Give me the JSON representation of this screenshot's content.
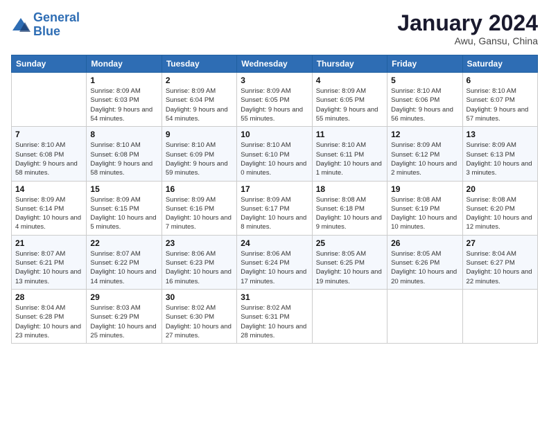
{
  "logo": {
    "line1": "General",
    "line2": "Blue"
  },
  "title": "January 2024",
  "subtitle": "Awu, Gansu, China",
  "weekdays": [
    "Sunday",
    "Monday",
    "Tuesday",
    "Wednesday",
    "Thursday",
    "Friday",
    "Saturday"
  ],
  "weeks": [
    [
      {
        "day": "",
        "sunrise": "",
        "sunset": "",
        "daylight": ""
      },
      {
        "day": "1",
        "sunrise": "Sunrise: 8:09 AM",
        "sunset": "Sunset: 6:03 PM",
        "daylight": "Daylight: 9 hours and 54 minutes."
      },
      {
        "day": "2",
        "sunrise": "Sunrise: 8:09 AM",
        "sunset": "Sunset: 6:04 PM",
        "daylight": "Daylight: 9 hours and 54 minutes."
      },
      {
        "day": "3",
        "sunrise": "Sunrise: 8:09 AM",
        "sunset": "Sunset: 6:05 PM",
        "daylight": "Daylight: 9 hours and 55 minutes."
      },
      {
        "day": "4",
        "sunrise": "Sunrise: 8:09 AM",
        "sunset": "Sunset: 6:05 PM",
        "daylight": "Daylight: 9 hours and 55 minutes."
      },
      {
        "day": "5",
        "sunrise": "Sunrise: 8:10 AM",
        "sunset": "Sunset: 6:06 PM",
        "daylight": "Daylight: 9 hours and 56 minutes."
      },
      {
        "day": "6",
        "sunrise": "Sunrise: 8:10 AM",
        "sunset": "Sunset: 6:07 PM",
        "daylight": "Daylight: 9 hours and 57 minutes."
      }
    ],
    [
      {
        "day": "7",
        "sunrise": "Sunrise: 8:10 AM",
        "sunset": "Sunset: 6:08 PM",
        "daylight": "Daylight: 9 hours and 58 minutes."
      },
      {
        "day": "8",
        "sunrise": "Sunrise: 8:10 AM",
        "sunset": "Sunset: 6:08 PM",
        "daylight": "Daylight: 9 hours and 58 minutes."
      },
      {
        "day": "9",
        "sunrise": "Sunrise: 8:10 AM",
        "sunset": "Sunset: 6:09 PM",
        "daylight": "Daylight: 9 hours and 59 minutes."
      },
      {
        "day": "10",
        "sunrise": "Sunrise: 8:10 AM",
        "sunset": "Sunset: 6:10 PM",
        "daylight": "Daylight: 10 hours and 0 minutes."
      },
      {
        "day": "11",
        "sunrise": "Sunrise: 8:10 AM",
        "sunset": "Sunset: 6:11 PM",
        "daylight": "Daylight: 10 hours and 1 minute."
      },
      {
        "day": "12",
        "sunrise": "Sunrise: 8:09 AM",
        "sunset": "Sunset: 6:12 PM",
        "daylight": "Daylight: 10 hours and 2 minutes."
      },
      {
        "day": "13",
        "sunrise": "Sunrise: 8:09 AM",
        "sunset": "Sunset: 6:13 PM",
        "daylight": "Daylight: 10 hours and 3 minutes."
      }
    ],
    [
      {
        "day": "14",
        "sunrise": "Sunrise: 8:09 AM",
        "sunset": "Sunset: 6:14 PM",
        "daylight": "Daylight: 10 hours and 4 minutes."
      },
      {
        "day": "15",
        "sunrise": "Sunrise: 8:09 AM",
        "sunset": "Sunset: 6:15 PM",
        "daylight": "Daylight: 10 hours and 5 minutes."
      },
      {
        "day": "16",
        "sunrise": "Sunrise: 8:09 AM",
        "sunset": "Sunset: 6:16 PM",
        "daylight": "Daylight: 10 hours and 7 minutes."
      },
      {
        "day": "17",
        "sunrise": "Sunrise: 8:09 AM",
        "sunset": "Sunset: 6:17 PM",
        "daylight": "Daylight: 10 hours and 8 minutes."
      },
      {
        "day": "18",
        "sunrise": "Sunrise: 8:08 AM",
        "sunset": "Sunset: 6:18 PM",
        "daylight": "Daylight: 10 hours and 9 minutes."
      },
      {
        "day": "19",
        "sunrise": "Sunrise: 8:08 AM",
        "sunset": "Sunset: 6:19 PM",
        "daylight": "Daylight: 10 hours and 10 minutes."
      },
      {
        "day": "20",
        "sunrise": "Sunrise: 8:08 AM",
        "sunset": "Sunset: 6:20 PM",
        "daylight": "Daylight: 10 hours and 12 minutes."
      }
    ],
    [
      {
        "day": "21",
        "sunrise": "Sunrise: 8:07 AM",
        "sunset": "Sunset: 6:21 PM",
        "daylight": "Daylight: 10 hours and 13 minutes."
      },
      {
        "day": "22",
        "sunrise": "Sunrise: 8:07 AM",
        "sunset": "Sunset: 6:22 PM",
        "daylight": "Daylight: 10 hours and 14 minutes."
      },
      {
        "day": "23",
        "sunrise": "Sunrise: 8:06 AM",
        "sunset": "Sunset: 6:23 PM",
        "daylight": "Daylight: 10 hours and 16 minutes."
      },
      {
        "day": "24",
        "sunrise": "Sunrise: 8:06 AM",
        "sunset": "Sunset: 6:24 PM",
        "daylight": "Daylight: 10 hours and 17 minutes."
      },
      {
        "day": "25",
        "sunrise": "Sunrise: 8:05 AM",
        "sunset": "Sunset: 6:25 PM",
        "daylight": "Daylight: 10 hours and 19 minutes."
      },
      {
        "day": "26",
        "sunrise": "Sunrise: 8:05 AM",
        "sunset": "Sunset: 6:26 PM",
        "daylight": "Daylight: 10 hours and 20 minutes."
      },
      {
        "day": "27",
        "sunrise": "Sunrise: 8:04 AM",
        "sunset": "Sunset: 6:27 PM",
        "daylight": "Daylight: 10 hours and 22 minutes."
      }
    ],
    [
      {
        "day": "28",
        "sunrise": "Sunrise: 8:04 AM",
        "sunset": "Sunset: 6:28 PM",
        "daylight": "Daylight: 10 hours and 23 minutes."
      },
      {
        "day": "29",
        "sunrise": "Sunrise: 8:03 AM",
        "sunset": "Sunset: 6:29 PM",
        "daylight": "Daylight: 10 hours and 25 minutes."
      },
      {
        "day": "30",
        "sunrise": "Sunrise: 8:02 AM",
        "sunset": "Sunset: 6:30 PM",
        "daylight": "Daylight: 10 hours and 27 minutes."
      },
      {
        "day": "31",
        "sunrise": "Sunrise: 8:02 AM",
        "sunset": "Sunset: 6:31 PM",
        "daylight": "Daylight: 10 hours and 28 minutes."
      },
      {
        "day": "",
        "sunrise": "",
        "sunset": "",
        "daylight": ""
      },
      {
        "day": "",
        "sunrise": "",
        "sunset": "",
        "daylight": ""
      },
      {
        "day": "",
        "sunrise": "",
        "sunset": "",
        "daylight": ""
      }
    ]
  ]
}
